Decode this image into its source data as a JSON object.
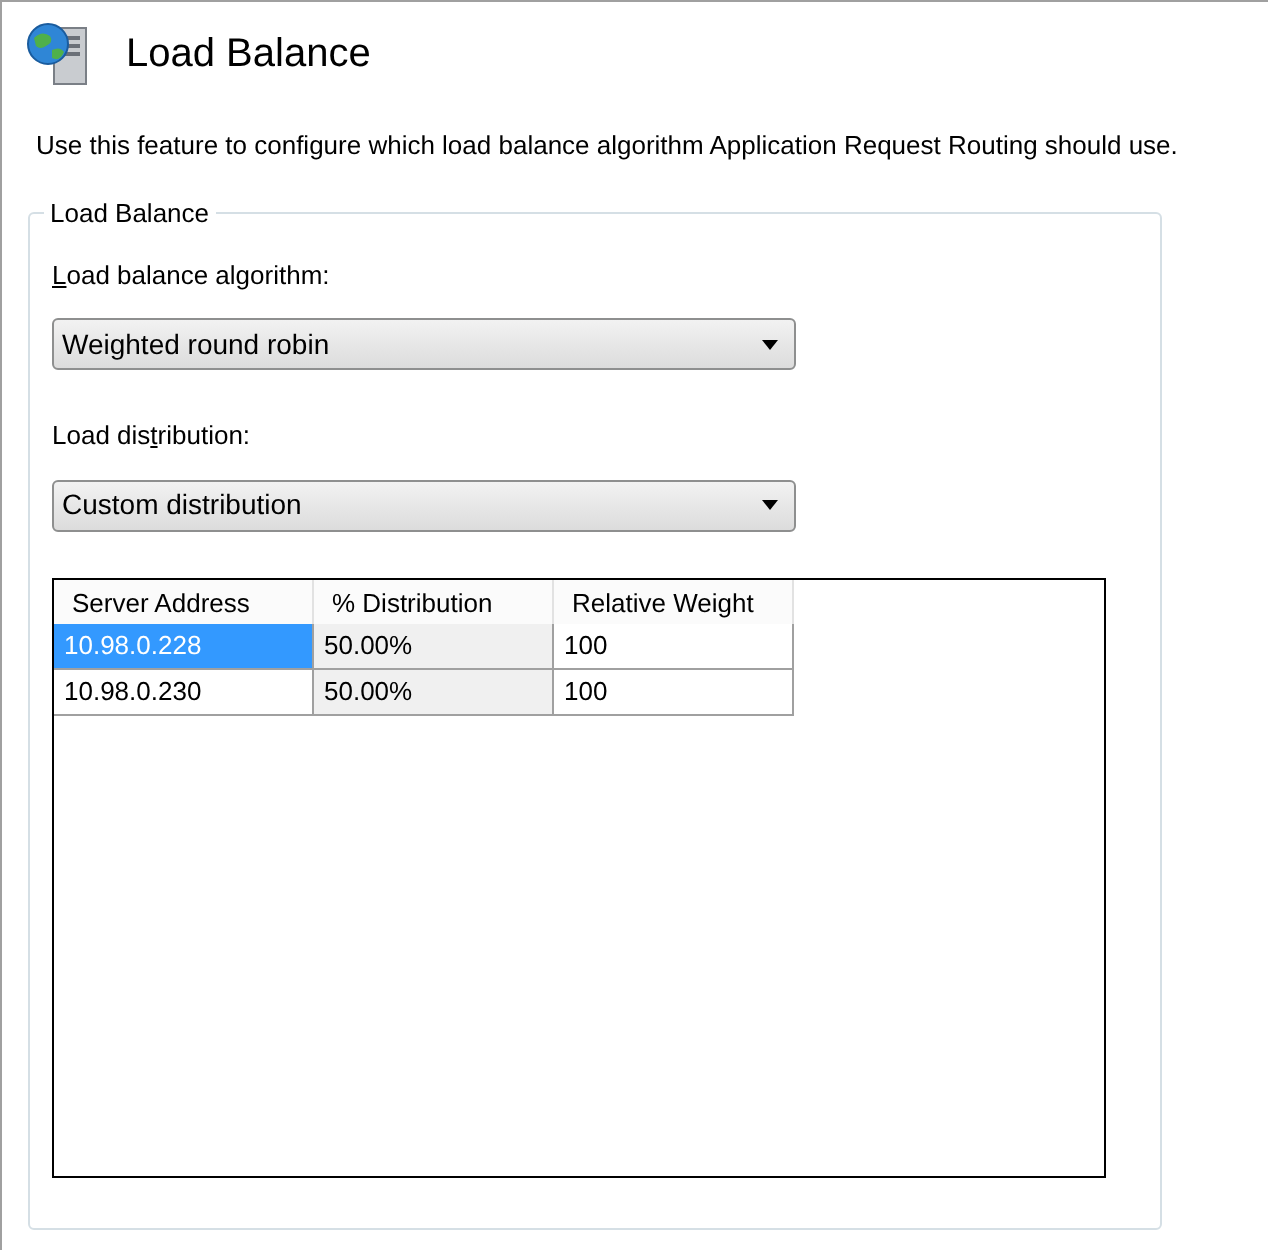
{
  "header": {
    "title": "Load Balance"
  },
  "description": "Use this feature to configure which load balance algorithm Application Request Routing should use.",
  "group": {
    "legend": "Load Balance",
    "fields": [
      {
        "label": {
          "key": "L",
          "after": "oad balance algorithm:"
        },
        "value": "Weighted round robin"
      },
      {
        "label": {
          "before": "Load dis",
          "key": "t",
          "after": "ribution:"
        },
        "value": "Custom distribution"
      }
    ],
    "table": {
      "columns": [
        "Server Address",
        "% Distribution",
        "Relative Weight"
      ],
      "rows": [
        {
          "selected": true,
          "cells": [
            "10.98.0.228",
            "50.00%",
            "100"
          ]
        },
        {
          "selected": false,
          "cells": [
            "10.98.0.230",
            "50.00%",
            "100"
          ]
        }
      ]
    }
  }
}
